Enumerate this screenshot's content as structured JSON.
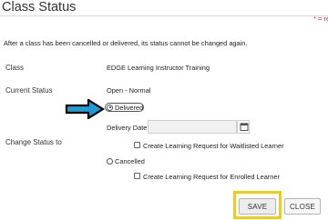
{
  "header": {
    "title": "Class Status",
    "required_note": "* = requi"
  },
  "notice": "After a class has been cancelled or delivered, its status cannot be changed again.",
  "form": {
    "class_label": "Class",
    "class_value": "EDGE Learning Instructor Training",
    "current_status_label": "Current Status",
    "current_status_value": "Open - Normal",
    "change_status_label": "Change Status to",
    "option_delivered": "Delivered",
    "delivery_date_label": "Delivery Date",
    "delivery_date_value": "",
    "waitlisted_checkbox_label": "Create Learning Request for Waitlisted Learner",
    "option_cancelled": "Cancelled",
    "enrolled_checkbox_label": "Create Learning Request for Enrolled Learner",
    "selected_option": "Delivered"
  },
  "buttons": {
    "save": "SAVE",
    "close": "CLOSE"
  },
  "colors": {
    "highlight_border": "#f2cc14",
    "arrow_fill": "#1f9bd7",
    "required_red": "#d9342b"
  },
  "icons": {
    "calendar": "calendar-icon",
    "pointer": "arrow-right-icon"
  }
}
